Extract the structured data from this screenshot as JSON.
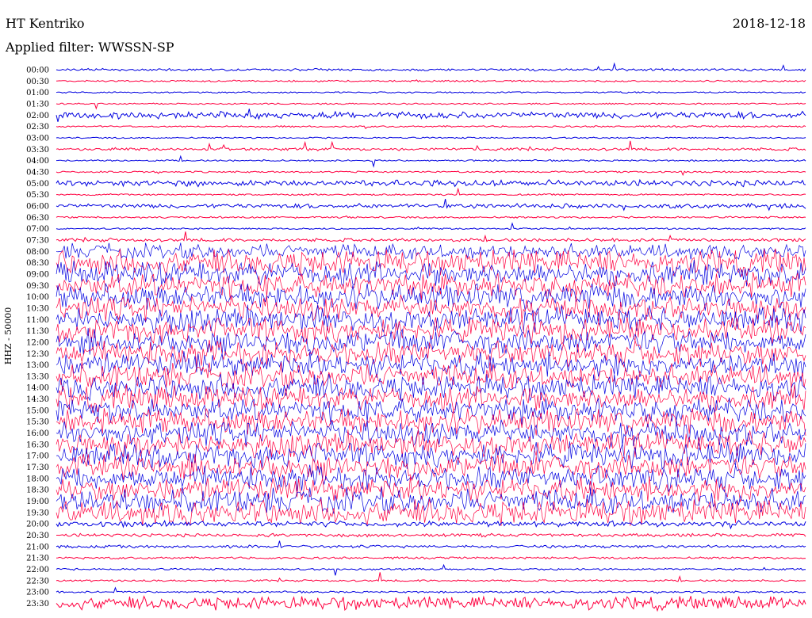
{
  "header": {
    "station": "HT Kentriko",
    "date": "2018-12-18",
    "filter": "Applied filter: WWSSN-SP"
  },
  "chart_data": {
    "type": "line",
    "title": "",
    "ylabel": "HHZ - 50000",
    "xlabel": "",
    "tick_labels": [
      "00:00",
      "00:30",
      "01:00",
      "01:30",
      "02:00",
      "02:30",
      "03:00",
      "03:30",
      "04:00",
      "04:30",
      "05:00",
      "05:30",
      "06:00",
      "06:30",
      "07:00",
      "07:30",
      "08:00",
      "08:30",
      "09:00",
      "09:30",
      "10:00",
      "10:30",
      "11:00",
      "11:30",
      "12:00",
      "12:30",
      "13:00",
      "13:30",
      "14:00",
      "14:30",
      "15:00",
      "15:30",
      "16:00",
      "16:30",
      "17:00",
      "17:30",
      "18:00",
      "18:30",
      "19:00",
      "19:30",
      "20:00",
      "20:30",
      "21:00",
      "21:30",
      "22:00",
      "22:30",
      "23:00",
      "23:30"
    ],
    "colors": {
      "even": "#0000e0",
      "odd": "#ff0040"
    },
    "activity": [
      0.06,
      0.03,
      0.02,
      0.02,
      0.25,
      0.03,
      0.02,
      0.08,
      0.03,
      0.03,
      0.22,
      0.03,
      0.15,
      0.04,
      0.03,
      0.1,
      0.6,
      1.0,
      1.0,
      1.0,
      1.0,
      1.0,
      1.0,
      1.0,
      1.0,
      1.0,
      1.0,
      1.0,
      1.0,
      1.0,
      1.0,
      1.0,
      1.0,
      1.0,
      1.0,
      1.0,
      1.0,
      1.0,
      1.0,
      1.0,
      0.2,
      0.1,
      0.08,
      0.05,
      0.04,
      0.04,
      0.04,
      0.5
    ]
  }
}
